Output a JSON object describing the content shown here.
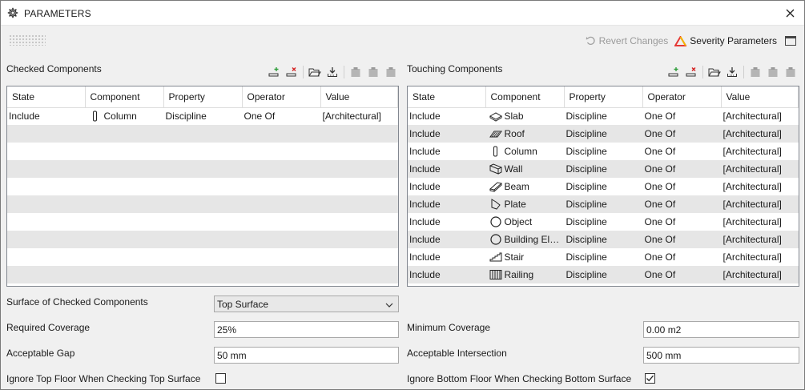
{
  "window": {
    "title": "PARAMETERS"
  },
  "top_toolbar": {
    "revert_label": "Revert Changes",
    "severity_label": "Severity Parameters"
  },
  "checked": {
    "title": "Checked Components",
    "columns": [
      "State",
      "Component",
      "Property",
      "Operator",
      "Value"
    ],
    "rows": [
      {
        "state": "Include",
        "icon": "column-icon",
        "component": "Column",
        "property": "Discipline",
        "operator": "One Of",
        "value": "[Architectural]"
      }
    ]
  },
  "touching": {
    "title": "Touching Components",
    "columns": [
      "State",
      "Component",
      "Property",
      "Operator",
      "Value"
    ],
    "rows": [
      {
        "state": "Include",
        "icon": "slab-icon",
        "component": "Slab",
        "property": "Discipline",
        "operator": "One Of",
        "value": "[Architectural]"
      },
      {
        "state": "Include",
        "icon": "roof-icon",
        "component": "Roof",
        "property": "Discipline",
        "operator": "One Of",
        "value": "[Architectural]"
      },
      {
        "state": "Include",
        "icon": "column-icon",
        "component": "Column",
        "property": "Discipline",
        "operator": "One Of",
        "value": "[Architectural]"
      },
      {
        "state": "Include",
        "icon": "wall-icon",
        "component": "Wall",
        "property": "Discipline",
        "operator": "One Of",
        "value": "[Architectural]"
      },
      {
        "state": "Include",
        "icon": "beam-icon",
        "component": "Beam",
        "property": "Discipline",
        "operator": "One Of",
        "value": "[Architectural]"
      },
      {
        "state": "Include",
        "icon": "plate-icon",
        "component": "Plate",
        "property": "Discipline",
        "operator": "One Of",
        "value": "[Architectural]"
      },
      {
        "state": "Include",
        "icon": "object-icon",
        "component": "Object",
        "property": "Discipline",
        "operator": "One Of",
        "value": "[Architectural]"
      },
      {
        "state": "Include",
        "icon": "object-icon",
        "component": "Building Ele...",
        "property": "Discipline",
        "operator": "One Of",
        "value": "[Architectural]"
      },
      {
        "state": "Include",
        "icon": "stair-icon",
        "component": "Stair",
        "property": "Discipline",
        "operator": "One Of",
        "value": "[Architectural]"
      },
      {
        "state": "Include",
        "icon": "railing-icon",
        "component": "Railing",
        "property": "Discipline",
        "operator": "One Of",
        "value": "[Architectural]"
      }
    ]
  },
  "settings": {
    "surface_label": "Surface of Checked Components",
    "surface_value": "Top Surface",
    "required_coverage_label": "Required Coverage",
    "required_coverage_value": "25%",
    "acceptable_gap_label": "Acceptable Gap",
    "acceptable_gap_value": "50 mm",
    "ignore_top_label": "Ignore Top Floor When Checking Top Surface",
    "ignore_top_checked": false,
    "minimum_coverage_label": "Minimum Coverage",
    "minimum_coverage_value": "0.00 m2",
    "acceptable_intersection_label": "Acceptable Intersection",
    "acceptable_intersection_value": "500 mm",
    "ignore_bottom_label": "Ignore Bottom Floor When Checking Bottom Surface",
    "ignore_bottom_checked": true
  },
  "colors": {
    "accent_add": "#2e9e3a",
    "accent_remove": "#d32020",
    "severity_red": "#e53935",
    "severity_yellow": "#f5b700"
  }
}
